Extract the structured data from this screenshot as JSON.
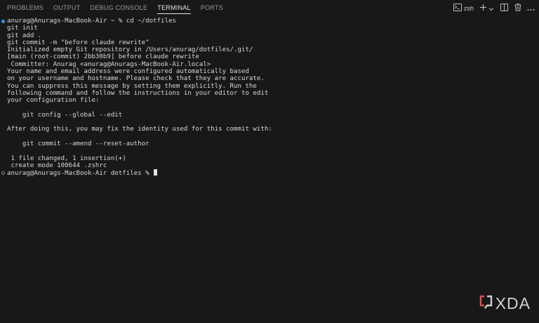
{
  "panel_tabs": [
    {
      "label": "PROBLEMS",
      "active": false
    },
    {
      "label": "OUTPUT",
      "active": false
    },
    {
      "label": "DEBUG CONSOLE",
      "active": false
    },
    {
      "label": "TERMINAL",
      "active": true
    },
    {
      "label": "PORTS",
      "active": false
    }
  ],
  "terminal_actions": {
    "shell_name": "zsh",
    "icons": [
      "terminal-icon",
      "plus-icon",
      "chevron-down-icon",
      "split-icon",
      "trash-icon",
      "more-icon"
    ]
  },
  "terminal": {
    "lines": [
      {
        "text": "anurag@Anurags-MacBook-Air ~ % cd ~/dotfiles",
        "marker": "filled"
      },
      {
        "text": "git init"
      },
      {
        "text": "git add ."
      },
      {
        "text": "git commit -m \"before claude rewrite\""
      },
      {
        "text": "Initialized empty Git repository in /Users/anurag/dotfiles/.git/"
      },
      {
        "text": "[main (root-commit) 2bb30b9] before claude rewrite"
      },
      {
        "text": " Committer: Anurag <anurag@Anurags-MacBook-Air.local>"
      },
      {
        "text": "Your name and email address were configured automatically based"
      },
      {
        "text": "on your username and hostname. Please check that they are accurate."
      },
      {
        "text": "You can suppress this message by setting them explicitly. Run the"
      },
      {
        "text": "following command and follow the instructions in your editor to edit"
      },
      {
        "text": "your configuration file:"
      },
      {
        "text": ""
      },
      {
        "text": "    git config --global --edit"
      },
      {
        "text": ""
      },
      {
        "text": "After doing this, you may fix the identity used for this commit with:"
      },
      {
        "text": ""
      },
      {
        "text": "    git commit --amend --reset-author"
      },
      {
        "text": ""
      },
      {
        "text": " 1 file changed, 1 insertion(+)"
      },
      {
        "text": " create mode 100644 .zshrc"
      },
      {
        "text": "anurag@Anurags-MacBook-Air dotfiles % ",
        "marker": "hollow",
        "cursor": true
      }
    ]
  },
  "watermark": {
    "text": "XDA"
  },
  "colors": {
    "background": "#181818",
    "active_tab": "#e6e6e6",
    "inactive_tab": "#9a9a9a",
    "success_marker": "#3794ff",
    "logo_accent": "#d9534f"
  }
}
